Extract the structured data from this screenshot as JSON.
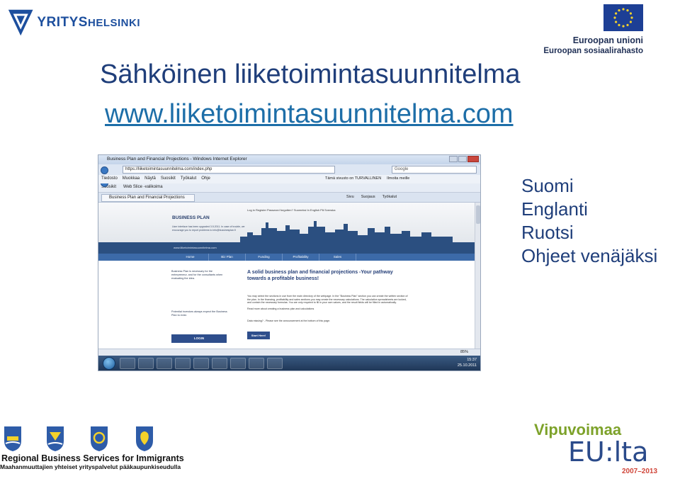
{
  "header": {
    "logo_yritys": "YRITYS",
    "logo_helsinki": "HELSINKI",
    "eu_line1": "Euroopan unioni",
    "eu_line2": "Euroopan sosiaalirahasto"
  },
  "title": "Sähköinen liiketoimintasuunnitelma",
  "url": "www.liiketoimintasuunnitelma.com",
  "browser": {
    "window_title": "Business Plan and Financial Projections - Windows Internet Explorer",
    "address": "https://liiketoimintasuunnitelma.com/index.php",
    "search_placeholder": "Google",
    "menu": [
      "Tiedosto",
      "Muokkaa",
      "Näytä",
      "Suosikit",
      "Työkalut",
      "Ohje"
    ],
    "security_items": [
      "Tämä sivusto on TURVALLINEN",
      "Ilmoita meille"
    ],
    "favorites": [
      "Suosikit",
      "Web Slice -valikoima"
    ],
    "tab": "Business Plan and Financial Projections",
    "commands": [
      "Sivu",
      "Suojaus",
      "Työkalut"
    ],
    "zoom": "85%",
    "clock_time": "15:37",
    "clock_date": "25.10.2011"
  },
  "site": {
    "heading": "BUSINESS PLAN",
    "top_links": "Log in    Register    Password forgotten?          Suomeksi    In English    På Svenska",
    "notice": "User interface has been upgraded 3.5.2011. In case of trouble, we encourage you to report problems to info@bussinesplan.fi",
    "band_url": "www.liiketoimintasuunnitelma.com",
    "nav": [
      "Home",
      "Biz Plan",
      "Funding",
      "Profitability",
      "Sales"
    ],
    "left_text": "Business Plan is necessary for the entrepreneur, and for the consultants when evaluating the idea.",
    "left_text2": "Potential investors always expect the Business Plan to exist.",
    "login": "LOGIN",
    "main_heading": "A solid business plan and financial projections -Your pathway towards a profitable business!",
    "main_body": "You may select the sections in use from the main directory of the webpage. In the \"Business Plan\" section you can create the written section of the plan. In the financing, profitability and sales sections you may create the necessary calculations. The calculation spreadsheets are locked, and contain the necessary formulas. You are only required to fill in your own values, and the result fields will be filled in automatically.",
    "main_read": "Read more about creating a business plan and calculations",
    "data_missing": "Data missing? - Please see the announcement at the bottom of this page.",
    "start": "Start Here!"
  },
  "languages": [
    "Suomi",
    "Englanti",
    "Ruotsi",
    "Ohjeet venäjäksi"
  ],
  "footer": {
    "rbs": "Regional Business Services for Immigrants",
    "maahanmuuttajien": "Maahanmuuttajien yhteiset yrityspalvelut pääkaupunkiseudulla",
    "vipuvoimaa": "Vipuvoimaa",
    "eulta": "EU:lta",
    "years": "2007–2013"
  }
}
